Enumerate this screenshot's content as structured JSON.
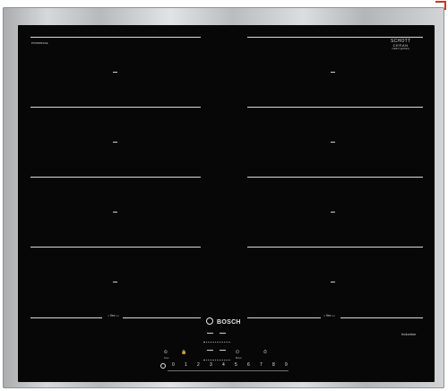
{
  "product": {
    "model_code": "PXX645FC1E",
    "brand": "BOSCH",
    "glass_brand": {
      "line1": "SCHOTT",
      "line2": "CERAN",
      "line3": "made in germany"
    },
    "flex_label_left": "○ flex ▭",
    "flex_label_right": "○ flex ▭",
    "technology_label": "Induction"
  },
  "controls": {
    "timer_icon": "⏲",
    "timer_label": "timer",
    "lock_icon": "🔒",
    "lock_label": "",
    "power_icon": "⏻",
    "boost_label": "Boost",
    "slider_values": [
      "0",
      "1",
      "2",
      "3",
      "4",
      "5",
      "6",
      "7",
      "8",
      "9"
    ]
  },
  "colors": {
    "glass": "#070707",
    "frame": "#c6c8ca",
    "print": "#d8d8d8",
    "corner_accent": "#c0392b"
  }
}
